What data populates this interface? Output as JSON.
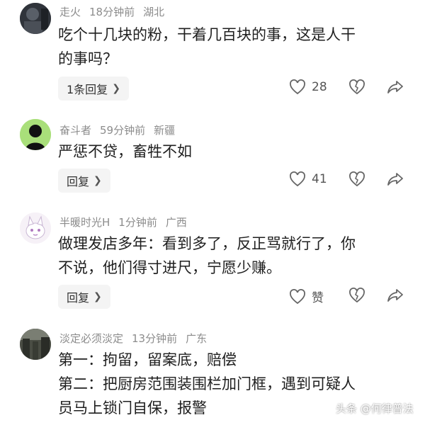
{
  "comments": [
    {
      "username": "走火",
      "time": "18分钟前",
      "location": "湖北",
      "lines": [
        "吃个十几块的粉，干着几百块的事，这是人干",
        "的事吗？"
      ],
      "reply_label": "1条回复",
      "like_count": "28",
      "avatar_icon": "dark-photo-avatar"
    },
    {
      "username": "奋斗者",
      "time": "59分钟前",
      "location": "新疆",
      "lines": [
        "严惩不贷，畜牲不如"
      ],
      "reply_label": "回复",
      "like_count": "41",
      "avatar_icon": "green-silhouette-avatar"
    },
    {
      "username": "半暖时光H",
      "time": "1分钟前",
      "location": "广西",
      "lines": [
        "做理发店多年：看到多了，反正骂就行了，你",
        "不说，他们得寸进尺，宁愿少赚。"
      ],
      "reply_label": "回复",
      "like_count": "赞",
      "avatar_icon": "cartoon-avatar"
    },
    {
      "username": "淡定必须淡定",
      "time": "13分钟前",
      "location": "广东",
      "lines": [
        "第一：拘留，留案底，赔偿",
        "第二：把厨房范围装围栏加门框，遇到可疑人",
        "员马上锁门自保，报警"
      ],
      "avatar_icon": "street-photo-avatar"
    }
  ],
  "watermark": "头条 @何律普法",
  "colors": {
    "text": "#1f1f1f",
    "meta": "#8c8c8c",
    "button_bg": "#f4f4f4",
    "icon": "#666666"
  }
}
